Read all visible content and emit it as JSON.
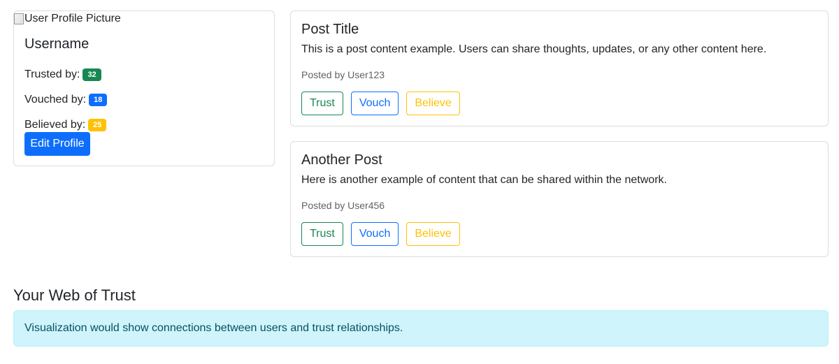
{
  "profile": {
    "picture_alt": "User Profile Picture",
    "username": "Username",
    "stats": [
      {
        "label": "Trusted by:",
        "count": "32",
        "color": "#198754"
      },
      {
        "label": "Vouched by:",
        "count": "18",
        "color": "#0d6efd"
      },
      {
        "label": "Believed by:",
        "count": "25",
        "color": "#ffc107"
      }
    ],
    "edit_button": "Edit Profile"
  },
  "posts": [
    {
      "title": "Post Title",
      "content": "This is a post content example. Users can share thoughts, updates, or any other content here.",
      "meta": "Posted by User123",
      "actions": {
        "trust": "Trust",
        "vouch": "Vouch",
        "believe": "Believe"
      }
    },
    {
      "title": "Another Post",
      "content": "Here is another example of content that can be shared within the network.",
      "meta": "Posted by User456",
      "actions": {
        "trust": "Trust",
        "vouch": "Vouch",
        "believe": "Believe"
      }
    }
  ],
  "web_of_trust": {
    "title": "Your Web of Trust",
    "message": "Visualization would show connections between users and trust relationships."
  },
  "colors": {
    "primary": "#0d6efd",
    "success": "#198754",
    "warning": "#ffc107",
    "info_bg": "#cff4fc"
  }
}
